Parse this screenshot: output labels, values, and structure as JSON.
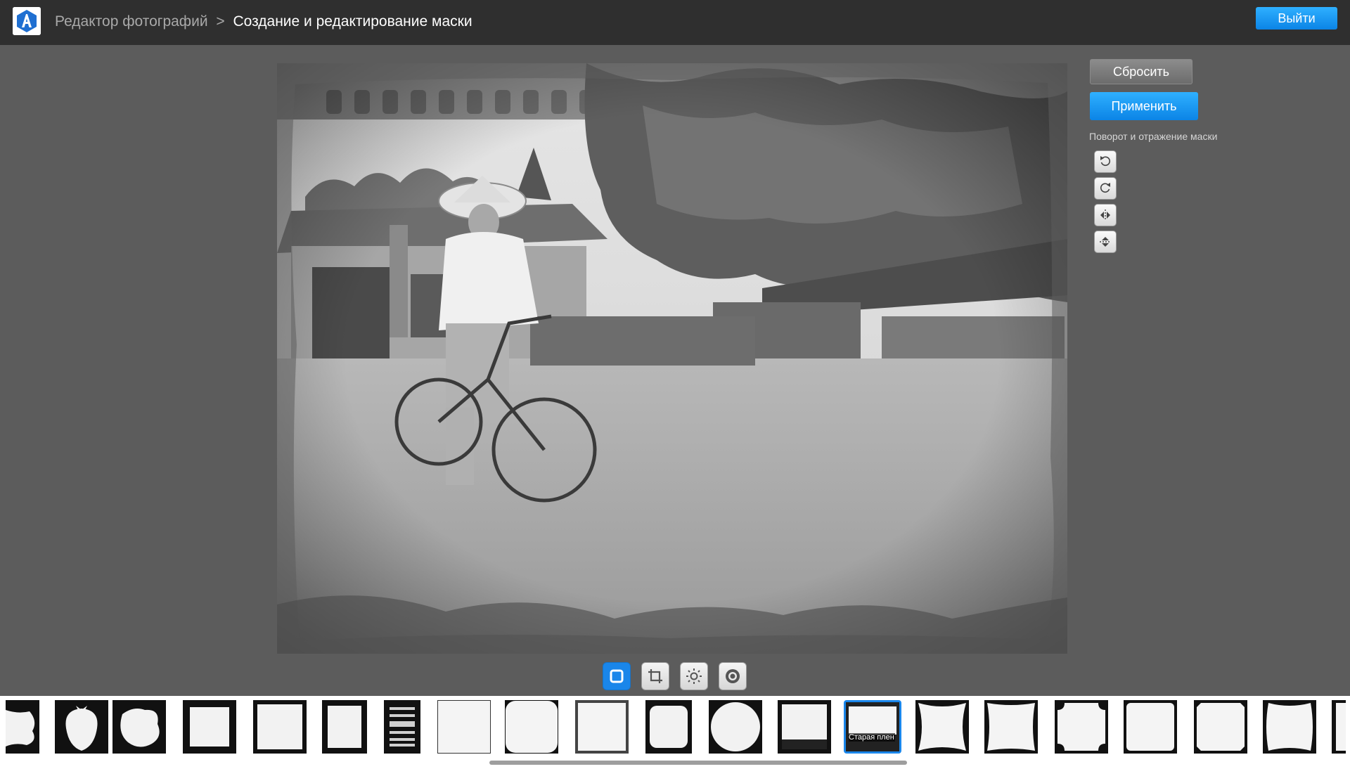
{
  "header": {
    "breadcrumb_root": "Редактор фотографий",
    "breadcrumb_separator": ">",
    "breadcrumb_current": "Создание и редактирование маски",
    "exit_label": "Выйти"
  },
  "panel": {
    "reset_label": "Сбросить",
    "apply_label": "Применить",
    "rotate_title": "Поворот и отражение маски",
    "tools": [
      "rotate-left-icon",
      "rotate-right-icon",
      "flip-horizontal-icon",
      "flip-vertical-icon"
    ]
  },
  "modes": {
    "items": [
      "mask-mode-icon",
      "crop-icon",
      "brightness-icon",
      "effects-icon"
    ],
    "active": "mask-mode-icon"
  },
  "masks": {
    "selected_label": "Старая плен"
  },
  "colors": {
    "accent": "#1a86ea",
    "header_bg": "#2f2f2f",
    "workspace_bg": "#5c5c5c"
  }
}
